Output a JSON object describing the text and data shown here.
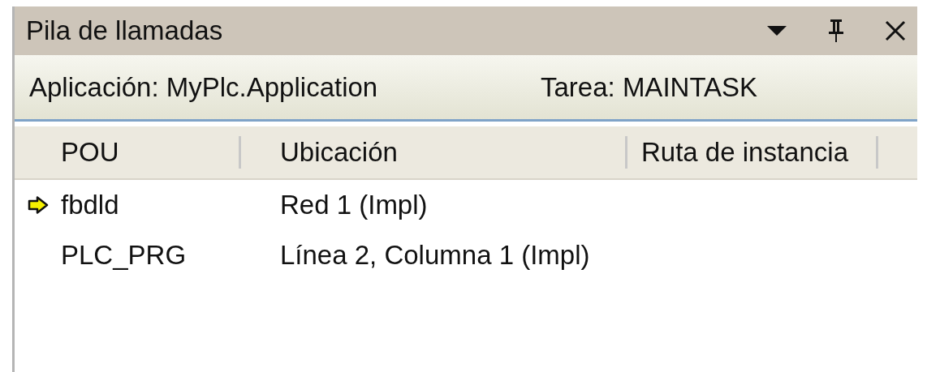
{
  "window": {
    "title": "Pila de llamadas"
  },
  "info": {
    "application": "Aplicación: MyPlc.Application",
    "task": "Tarea: MAINTASK"
  },
  "table": {
    "columns": [
      "POU",
      "Ubicación",
      "Ruta de instancia"
    ],
    "rows": [
      {
        "current": true,
        "cells": [
          "fbdld",
          "Red 1 (Impl)"
        ]
      },
      {
        "current": false,
        "cells": [
          "PLC_PRG",
          "Línea 2, Columna 1 (Impl)"
        ]
      }
    ]
  }
}
